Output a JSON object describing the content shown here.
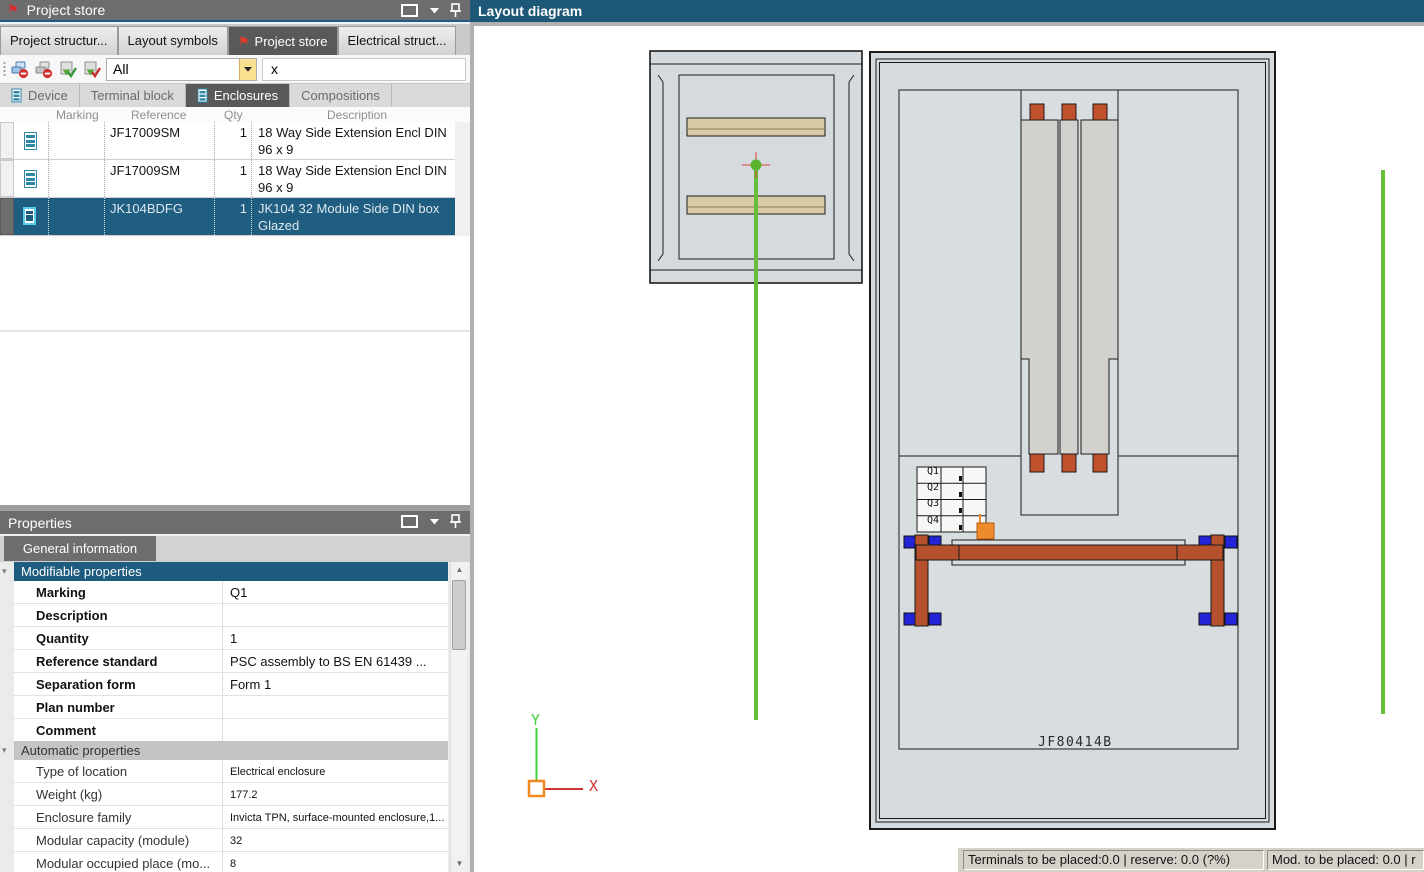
{
  "colors": {
    "accent_teal": "#1d5c7e",
    "selection_row": "#1f5e81",
    "panel_title_gray": "#6d6d6d",
    "active_tab_dark": "#595959",
    "busbar_rust": "#b5522d",
    "terminal_orange": "#c1512c",
    "highlight_orange": "#ee8c2c",
    "mount_blue": "#2323d8",
    "construction_green": "#66be39",
    "axis_green": "#3fcf3f",
    "axis_red": "#d23232",
    "enclosure_gray": "#d5dade"
  },
  "icons": {
    "title_flag": "red-flag",
    "window_restore": "restore-square",
    "window_menu": "down-caret",
    "window_pin": "push-pin",
    "toolbar": [
      "device-remove-blue",
      "device-remove-gray",
      "import-check-green",
      "import-check-red"
    ],
    "dropdown_arrow": "down-triangle"
  },
  "left_panel": {
    "title": "Project store",
    "window_tabs": {
      "t0": "Project structur...",
      "t1": "Layout symbols",
      "t2": "Project store",
      "t3": "Electrical struct..."
    },
    "toolbar": {
      "filter_value": "All",
      "search_value": "x"
    },
    "subtabs": {
      "t0": "Device",
      "t1": "Terminal block",
      "t2": "Enclosures",
      "t3": "Compositions"
    },
    "table": {
      "headers": {
        "marking": "Marking",
        "reference": "Reference",
        "qty": "Qty",
        "description": "Description"
      },
      "rows": [
        {
          "marking": "",
          "reference": "JF17009SM",
          "qty": "1",
          "description": "18 Way Side Extension Encl DIN 96 x 9"
        },
        {
          "marking": "",
          "reference": "JF17009SM",
          "qty": "1",
          "description": "18 Way Side Extension Encl DIN 96 x 9"
        },
        {
          "marking": "",
          "reference": "JK104BDFG",
          "qty": "1",
          "description": "JK104 32 Module Side DIN box Glazed"
        }
      ]
    }
  },
  "properties_panel": {
    "title": "Properties",
    "tab": "General information",
    "modifiable": {
      "header": "Modifiable properties",
      "rows": [
        {
          "label": "Marking",
          "value": "Q1"
        },
        {
          "label": "Description",
          "value": ""
        },
        {
          "label": "Quantity",
          "value": "1"
        },
        {
          "label": "Reference standard",
          "value": "PSC assembly to BS EN 61439 ..."
        },
        {
          "label": "Separation form",
          "value": "Form 1"
        },
        {
          "label": "Plan number",
          "value": ""
        },
        {
          "label": "Comment",
          "value": ""
        }
      ]
    },
    "automatic": {
      "header": "Automatic properties",
      "rows": [
        {
          "label": "Type of location",
          "value": "Electrical enclosure"
        },
        {
          "label": "Weight (kg)",
          "value": "177.2"
        },
        {
          "label": "Enclosure family",
          "value": "Invicta TPN, surface-mounted enclosure,1..."
        },
        {
          "label": "Modular capacity (module)",
          "value": "32"
        },
        {
          "label": "Modular occupied place (mo...",
          "value": "8"
        }
      ]
    }
  },
  "layout_panel": {
    "title": "Layout diagram",
    "enclosure_label": "JF80414B",
    "module_table": {
      "r0": "Q1",
      "r1": "Q2",
      "r2": "Q3",
      "r3": "Q4"
    },
    "axes": {
      "x": "X",
      "y": "Y"
    },
    "status": {
      "terminals": "Terminals to be placed:0.0 | reserve: 0.0 (?%)",
      "modules": "Mod. to be placed: 0.0 | r"
    }
  }
}
